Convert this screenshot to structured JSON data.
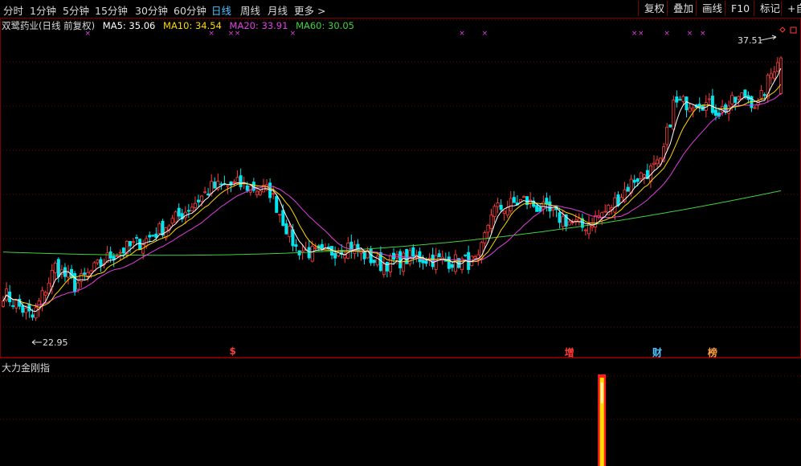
{
  "toolbar": {
    "periods": [
      {
        "label": "分时",
        "active": false
      },
      {
        "label": "1分钟",
        "active": false
      },
      {
        "label": "5分钟",
        "active": false
      },
      {
        "label": "15分钟",
        "active": false
      },
      {
        "label": "30分钟",
        "active": false
      },
      {
        "label": "60分钟",
        "active": false
      },
      {
        "label": "日线",
        "active": true
      },
      {
        "label": "周线",
        "active": false
      },
      {
        "label": "月线",
        "active": false
      },
      {
        "label": "更多 >",
        "active": false
      }
    ],
    "buttons": [
      "复权",
      "叠加",
      "画线",
      "F10",
      "标记",
      "+自"
    ]
  },
  "legend": {
    "stock": "双鹭药业(日线 前复权)",
    "ma5": "MA5: 35.06",
    "ma10": "MA10: 34.54",
    "ma20": "MA20: 33.91",
    "ma60": "MA60: 30.05"
  },
  "colors": {
    "up": "#ff3c3c",
    "down": "#00e5ee",
    "ma5": "#ffffff",
    "ma10": "#ffd700",
    "ma20": "#e040e0",
    "ma60": "#40d040",
    "grid": "#7a0000",
    "marker": "#e040e0"
  },
  "annotations": {
    "high_label": "37.51",
    "low_label": "22.95"
  },
  "events": [
    {
      "label": "$",
      "color": "#ff3c3c",
      "index": 71
    },
    {
      "label": "增",
      "color": "#ff3c3c",
      "index": 174
    },
    {
      "label": "财",
      "color": "#4fc3ff",
      "index": 201
    },
    {
      "label": "榜",
      "color": "#ffa040",
      "index": 218
    }
  ],
  "sub_indicator": {
    "title": "大力金刚指"
  },
  "chart_data": {
    "type": "candlestick",
    "count": 240,
    "ylim": [
      20.9,
      39.4
    ],
    "waypoints": [
      [
        0,
        24.3
      ],
      [
        9,
        22.9
      ],
      [
        16,
        25.8
      ],
      [
        22,
        24.7
      ],
      [
        33,
        26.4
      ],
      [
        44,
        27.3
      ],
      [
        54,
        28.6
      ],
      [
        64,
        30.2
      ],
      [
        72,
        30.4
      ],
      [
        82,
        30.0
      ],
      [
        90,
        26.8
      ],
      [
        98,
        26.4
      ],
      [
        106,
        27.0
      ],
      [
        116,
        25.9
      ],
      [
        126,
        26.3
      ],
      [
        136,
        26.1
      ],
      [
        146,
        26.0
      ],
      [
        150,
        28.9
      ],
      [
        160,
        29.5
      ],
      [
        170,
        28.6
      ],
      [
        178,
        28.0
      ],
      [
        186,
        29.0
      ],
      [
        194,
        30.7
      ],
      [
        202,
        31.5
      ],
      [
        206,
        34.9
      ],
      [
        214,
        35.1
      ],
      [
        220,
        34.5
      ],
      [
        228,
        35.4
      ],
      [
        232,
        34.8
      ],
      [
        238,
        37.5
      ]
    ],
    "ma60_start": 26.6,
    "ma60_end": 30.05,
    "sub_signal_index": 184,
    "markers": [
      26,
      64,
      70,
      72,
      89,
      141,
      148,
      194,
      196,
      204,
      211,
      215
    ]
  }
}
